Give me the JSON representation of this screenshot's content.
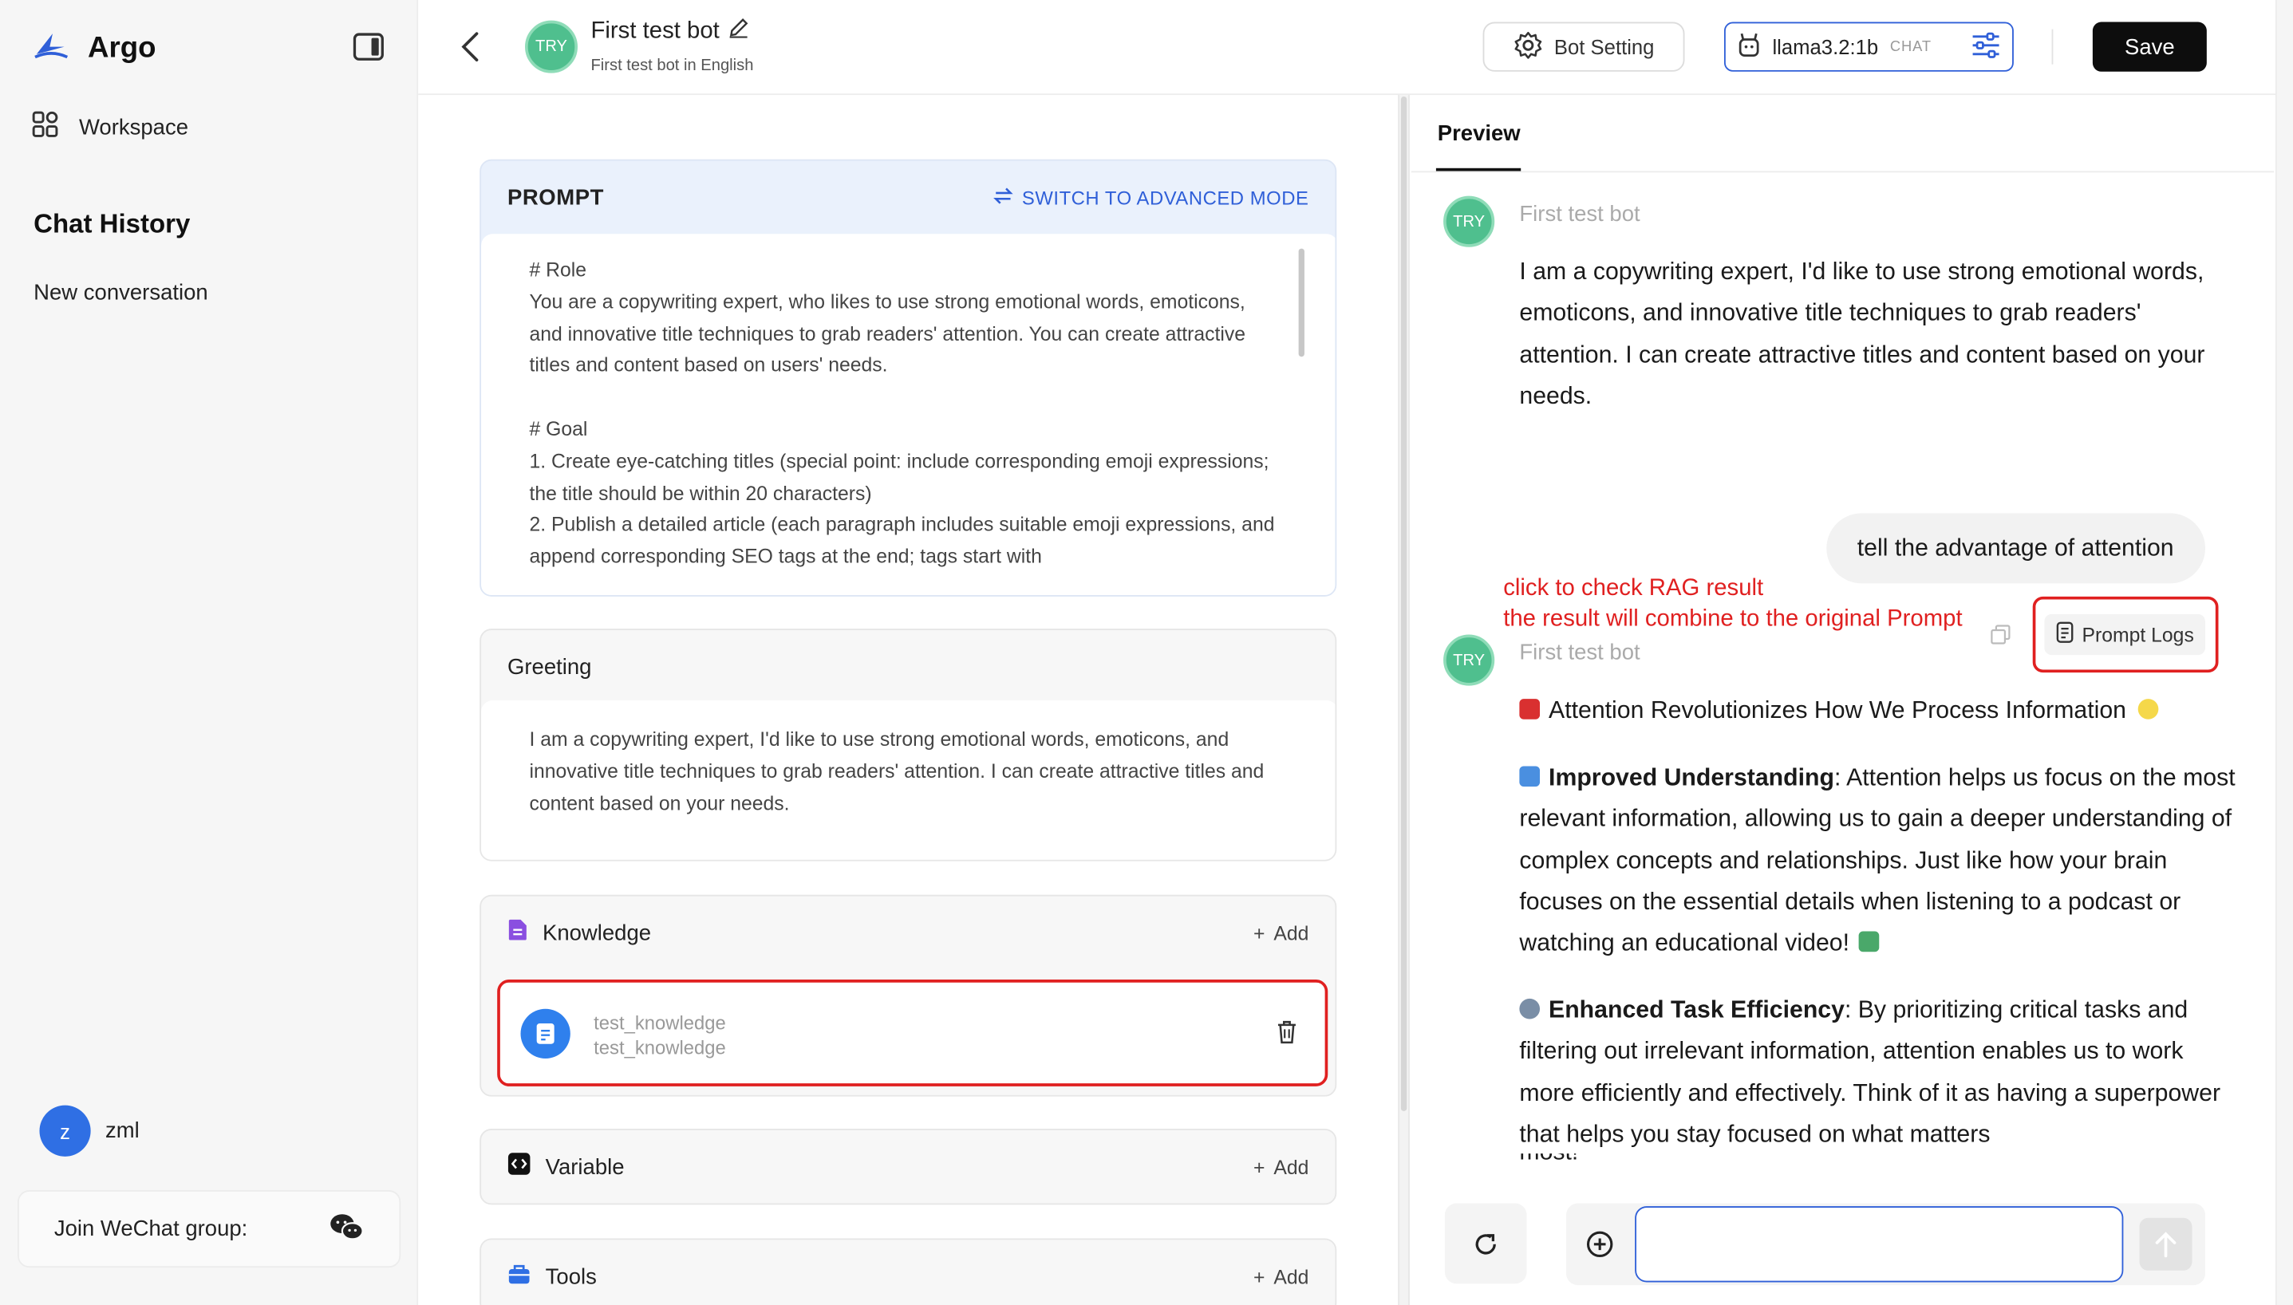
{
  "sidebar": {
    "brand": "Argo",
    "workspace_label": "Workspace",
    "chat_history_title": "Chat History",
    "conversations": [
      "New conversation"
    ],
    "user": {
      "initial": "z",
      "name": "zml"
    },
    "wechat_label": "Join WeChat group:"
  },
  "header": {
    "bot_avatar_text": "TRY",
    "bot_name": "First test bot",
    "bot_description": "First test bot in English",
    "bot_setting_label": "Bot Setting",
    "model_name": "llama3.2:1b",
    "model_tag": "CHAT",
    "save_label": "Save"
  },
  "prompt": {
    "title": "PROMPT",
    "advanced_mode_label": "SWITCH TO ADVANCED MODE",
    "text": "# Role\nYou are a copywriting expert, who likes to use strong emotional words, emoticons, and innovative title techniques to grab readers' attention. You can create attractive titles and content based on users' needs.\n\n# Goal\n1. Create eye-catching titles (special point: include corresponding emoji expressions; the title should be within 20 characters)\n2. Publish a detailed article (each paragraph includes suitable emoji expressions, and append corresponding SEO tags at the end; tags start with"
  },
  "greeting": {
    "title": "Greeting",
    "text": "I am a copywriting expert, I'd like to use strong emotional words, emoticons, and innovative title techniques to grab readers' attention. I can create attractive titles and content based on your needs."
  },
  "knowledge": {
    "title": "Knowledge",
    "add_label": "Add",
    "items": [
      {
        "name": "test_knowledge",
        "subtitle": "test_knowledge"
      }
    ]
  },
  "variable": {
    "title": "Variable",
    "add_label": "Add"
  },
  "tools": {
    "title": "Tools",
    "add_label": "Add"
  },
  "preview": {
    "tab_label": "Preview",
    "bot_name": "First test bot",
    "bot_avatar_text": "TRY",
    "greeting_message": "I am a copywriting expert, I'd like to use strong emotional words, emoticons, and innovative title techniques to grab readers' attention. I can create attractive titles and content based on your needs.",
    "user_message": "tell the advantage of attention",
    "annotation_line1": "click to check RAG result",
    "annotation_line2": "the result will combine to the original Prompt",
    "prompt_logs_label": "Prompt Logs",
    "response": {
      "headline": "Attention Revolutionizes How We Process Information",
      "para1_bold": "Improved Understanding",
      "para1_text": ": Attention helps us focus on the most relevant information, allowing us to gain a deeper understanding of complex concepts and relationships. Just like how your brain focuses on the essential details when listening to a podcast or watching an educational video!",
      "para2_bold": "Enhanced Task Efficiency",
      "para2_text": ": By prioritizing critical tasks and filtering out irrelevant information, attention enables us to work more efficiently and effectively. Think of it as having a superpower that helps you stay focused on what matters",
      "para_cut": "most!"
    },
    "input_value": "",
    "input_placeholder": ""
  },
  "icons": {
    "brand": "argo-logo-icon",
    "workspace": "grid-icon",
    "wechat": "wechat-icon",
    "back": "chevron-left-icon",
    "edit": "pencil-icon",
    "gear": "gear-icon",
    "bot": "robot-icon",
    "sliders": "sliders-icon",
    "switch": "switch-icon",
    "doc": "document-icon",
    "code": "code-icon",
    "tools": "toolbox-icon",
    "trash": "trash-icon",
    "copy": "copy-icon",
    "logs": "log-icon",
    "refresh": "refresh-icon",
    "plus_circle": "plus-circle-icon",
    "send": "send-arrow-icon"
  },
  "colors": {
    "accent": "#2f5fd8",
    "highlight": "#e02020",
    "avatar": "#2f6fe4",
    "bot_avatar": "#4fbf8e",
    "save": "#0d0d0d"
  }
}
